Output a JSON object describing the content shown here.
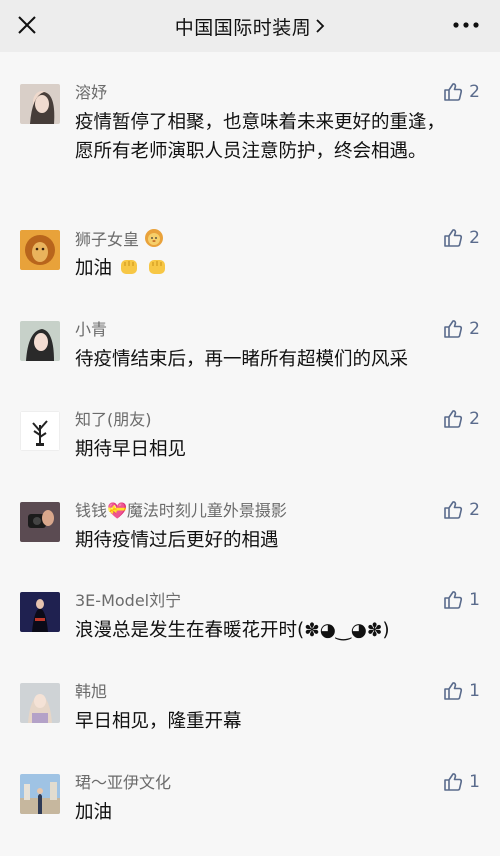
{
  "header": {
    "title": "中国国际时装周",
    "icons": {
      "close": "close-icon",
      "chevron": "chevron-right-icon",
      "more": "more-icon"
    }
  },
  "comments": [
    {
      "name": "溶妤",
      "text": "疫情暂停了相聚，也意味着未来更好的重逢，愿所有老师演职人员注意防护，终会相遇。",
      "likes": "2",
      "avatar": "avatar-photo-girl"
    },
    {
      "name": "狮子女皇",
      "text": "加油",
      "likes": "2",
      "avatar": "avatar-lion"
    },
    {
      "name": "小青",
      "text": "待疫情结束后，再一睹所有超模们的风采",
      "likes": "2",
      "avatar": "avatar-photo-girl"
    },
    {
      "name": "知了(朋友)",
      "text": "期待早日相见",
      "likes": "2",
      "avatar": "avatar-tree-logo"
    },
    {
      "name": "钱钱💝魔法时刻儿童外景摄影",
      "text": "期待疫情过后更好的相遇",
      "likes": "2",
      "avatar": "avatar-photo-dark"
    },
    {
      "name": "3E-Model刘宁",
      "text": "浪漫总是发生在春暖花开时(✽◕‿◕✽)",
      "likes": "1",
      "avatar": "avatar-photo-model"
    },
    {
      "name": "韩旭",
      "text": "早日相见，隆重开幕",
      "likes": "1",
      "avatar": "avatar-photo-light"
    },
    {
      "name": "珺～亚伊文化",
      "text": "加油",
      "likes": "1",
      "avatar": "avatar-photo-street"
    }
  ]
}
